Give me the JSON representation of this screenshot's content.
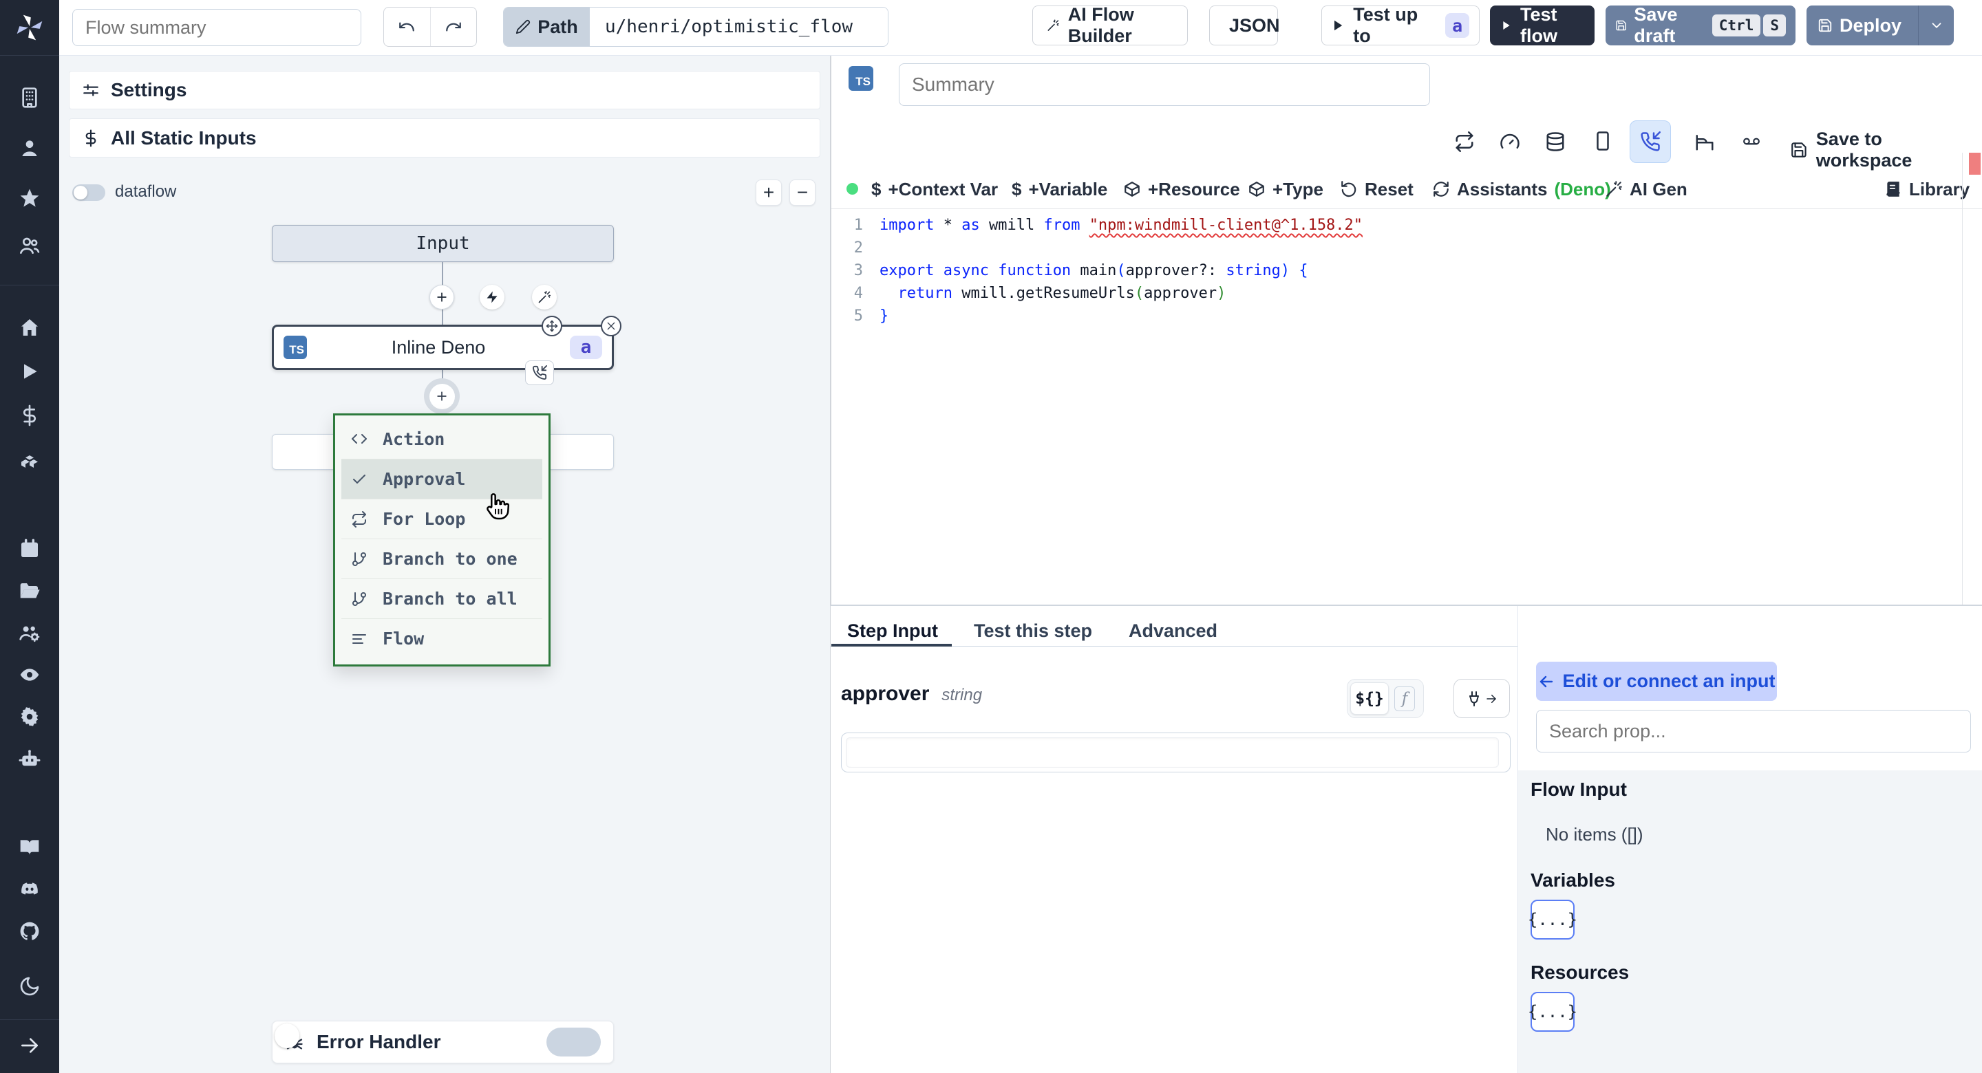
{
  "colors": {
    "accent_blue": "#3b82f6",
    "brand_dark": "#272e3f",
    "slate_button": "#6c80a0",
    "badge_indigo_bg": "#dfe3fb",
    "badge_indigo_text": "#4943c8",
    "menu_border_green": "#2d7a3c",
    "deno_green": "#27ae44",
    "status_green_dot": "#4ade80",
    "error_marker_red": "#ef7f7f",
    "keyword_blue": "#0b24fb",
    "string_red": "#a31515"
  },
  "topbar": {
    "flow_summary_placeholder": "Flow summary",
    "path_label": "Path",
    "path_value": "u/henri/optimistic_flow",
    "ai_flow_builder": "AI Flow Builder",
    "json": "JSON",
    "test_up_to": "Test up to",
    "test_up_to_badge": "a",
    "test_flow": "Test flow",
    "save_draft": "Save draft",
    "kbd_ctrl": "Ctrl",
    "kbd_s": "S",
    "deploy": "Deploy"
  },
  "sidebar": {
    "icons": [
      "windmill-logo",
      "building",
      "user",
      "star",
      "users",
      "home",
      "play",
      "dollar",
      "boxes",
      "calendar",
      "folder-open",
      "users-cog",
      "eye",
      "settings-gear",
      "bot",
      "book-open",
      "discord",
      "github",
      "moon",
      "arrow-right"
    ]
  },
  "flow_panel": {
    "settings": "Settings",
    "all_static_inputs": "All Static Inputs",
    "dataflow": "dataflow",
    "zoom_in": "+",
    "zoom_out": "−",
    "input_node": "Input",
    "step_node": {
      "lang_badge": "TS",
      "label": "Inline Deno",
      "id_badge": "a"
    },
    "menu": {
      "items": [
        {
          "icon": "code",
          "label": "Action"
        },
        {
          "icon": "check",
          "label": "Approval",
          "active": true
        },
        {
          "icon": "repeat",
          "label": "For Loop"
        },
        {
          "icon": "git-branch",
          "label": "Branch to one"
        },
        {
          "icon": "git-branch",
          "label": "Branch to all"
        },
        {
          "icon": "align-left",
          "label": "Flow"
        }
      ]
    },
    "error_handler": "Error Handler"
  },
  "editor": {
    "lang_badge": "TS",
    "summary_placeholder": "Summary",
    "header_icons": [
      "repeat",
      "gauge",
      "database",
      "smartphone",
      "phone-incoming",
      "bed",
      "voicemail"
    ],
    "save_to_workspace": "Save to workspace",
    "toolbar": {
      "context_var": "+Context Var",
      "variable": "+Variable",
      "resource": "+Resource",
      "type": "+Type",
      "reset": "Reset",
      "assistants": "Assistants",
      "assistants_lang": "(Deno)",
      "ai_gen": "AI Gen",
      "library": "Library",
      "dollar": "$"
    },
    "code": {
      "lines": [
        {
          "num": "1",
          "tokens": [
            [
              "import",
              "kw"
            ],
            [
              " * ",
              "pl"
            ],
            [
              "as",
              "kw"
            ],
            [
              " wmill ",
              "pl"
            ],
            [
              "from",
              "kw"
            ],
            [
              " ",
              "pl"
            ],
            [
              "\"npm:windmill-client@^1.158.2\"",
              "str"
            ]
          ]
        },
        {
          "num": "2",
          "tokens": []
        },
        {
          "num": "3",
          "tokens": [
            [
              "export",
              "kw"
            ],
            [
              " ",
              "pl"
            ],
            [
              "async",
              "kw"
            ],
            [
              " ",
              "pl"
            ],
            [
              "function",
              "kw"
            ],
            [
              " main",
              "pl"
            ],
            [
              "(",
              "b1"
            ],
            [
              "approver?: ",
              "pl"
            ],
            [
              "string",
              "kw"
            ],
            [
              ")",
              "b1"
            ],
            [
              " {",
              "b1"
            ]
          ]
        },
        {
          "num": "4",
          "tokens": [
            [
              "  ",
              "pl"
            ],
            [
              "return",
              "kw"
            ],
            [
              " wmill.getResumeUrls",
              "pl"
            ],
            [
              "(",
              "b2"
            ],
            [
              "approver",
              "pl"
            ],
            [
              ")",
              "b2"
            ]
          ]
        },
        {
          "num": "5",
          "tokens": [
            [
              "}",
              "b1"
            ]
          ]
        }
      ]
    }
  },
  "step_panel": {
    "tabs": [
      "Step Input",
      "Test this step",
      "Advanced"
    ],
    "active_tab": "Step Input",
    "field_name": "approver",
    "field_type": "string",
    "expr_toggle": "${}",
    "fn_toggle": "f",
    "field_value": ""
  },
  "connect_panel": {
    "edit_button": "Edit or connect an input",
    "search_placeholder": "Search prop...",
    "flow_input_title": "Flow Input",
    "flow_input_empty": "No items ([])",
    "variables_title": "Variables",
    "variables_chip": "{...}",
    "resources_title": "Resources",
    "resources_chip": "{...}"
  }
}
